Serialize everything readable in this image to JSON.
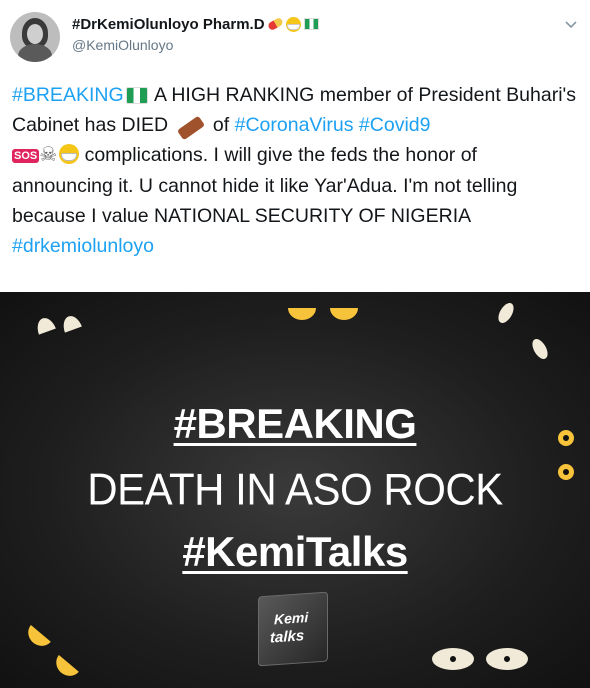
{
  "author": {
    "display_name": "#DrKemiOlunloyo Pharm.D",
    "handle": "@KemiOlunloyo",
    "avatar_icon": "profile-photo"
  },
  "tweet": {
    "seg1_tag": "#BREAKING",
    "seg2": " A HIGH RANKING member of President Buhari's Cabinet has DIED ",
    "seg3": " of ",
    "tag_coronavirus": "#CoronaVirus",
    "tag_covid9": "#Covid9",
    "sos": "SOS",
    "seg4": " complications. I will give the feds the honor of announcing it. U cannot hide it like Yar'Adua. I'm not telling because I value NATIONAL SECURITY OF NIGERIA",
    "tag_drkemi": "#drkemiolunloyo"
  },
  "media": {
    "line1": "#BREAKING",
    "line2": "DEATH IN ASO ROCK",
    "line3": "#KemiTalks",
    "logo_line1": "Kemi",
    "logo_line2": "talks"
  },
  "colors": {
    "link": "#1da1f2",
    "handle": "#657786",
    "image_bg": "#1e1e1e"
  }
}
